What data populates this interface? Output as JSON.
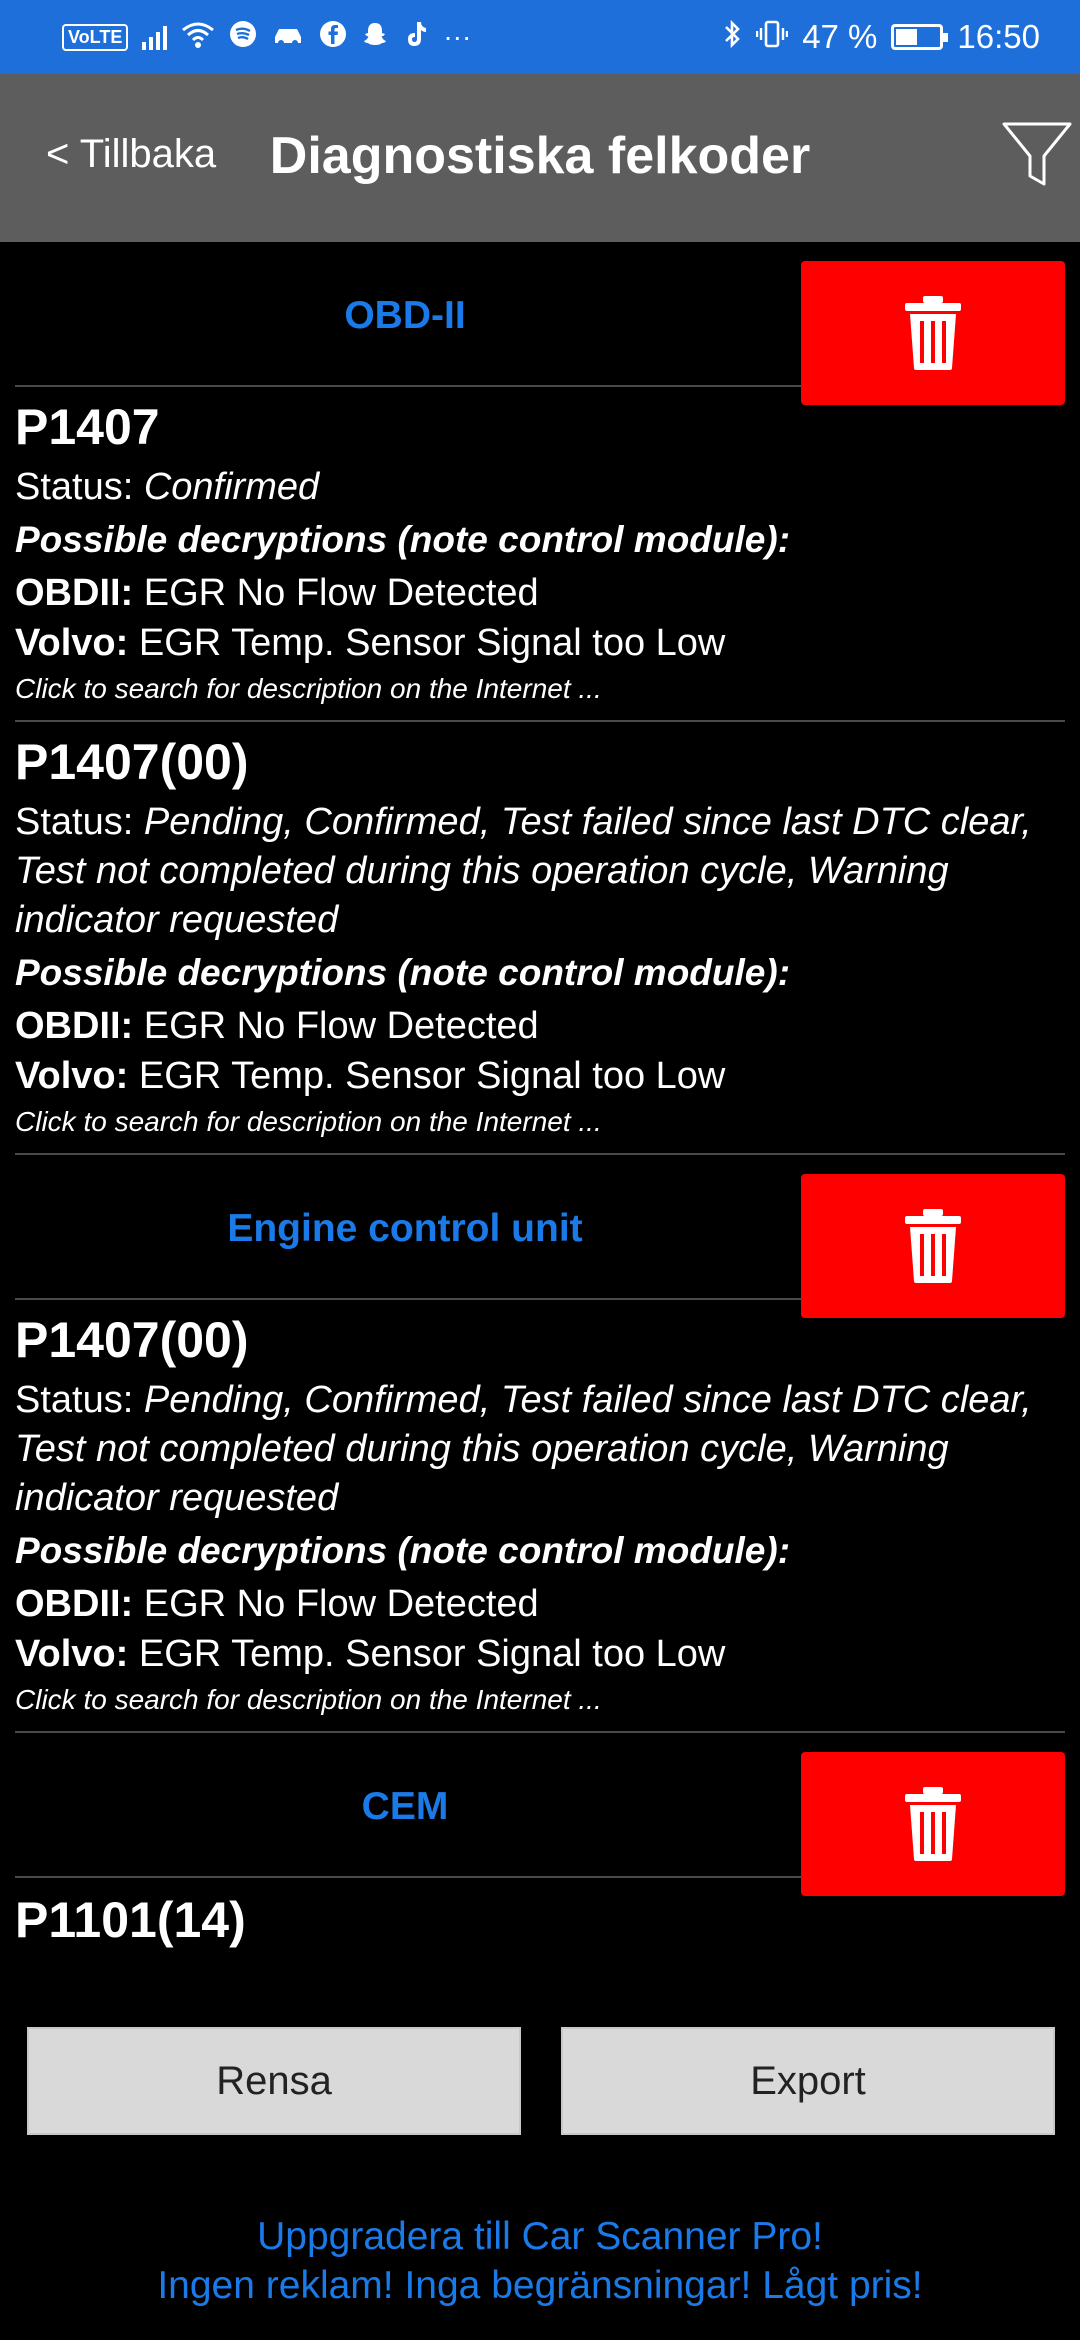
{
  "statusbar": {
    "volte": "VoLTE",
    "battery_text": "47 %",
    "battery_level": 0.47,
    "time": "16:50",
    "more": "···"
  },
  "header": {
    "back_label": "< Tillbaka",
    "title": "Diagnostiska felkoder",
    "filter_icon": "filter-icon"
  },
  "sections": [
    {
      "title": "OBD-II",
      "codes": [
        {
          "code": "P1407",
          "status_label": "Status: ",
          "status_value": "Confirmed",
          "possible": "Possible decryptions (note control module):",
          "obd_label": "OBDII:",
          "obd_text": " EGR No Flow Detected",
          "volvo_label": "Volvo:",
          "volvo_text": " EGR Temp. Sensor Signal too Low",
          "hint": "Click to search for description on the Internet ..."
        },
        {
          "code": "P1407(00)",
          "status_label": "Status: ",
          "status_value": "Pending, Confirmed, Test failed since last DTC clear, Test not completed during this operation cycle, Warning indicator requested",
          "possible": "Possible decryptions (note control module):",
          "obd_label": "OBDII:",
          "obd_text": " EGR No Flow Detected",
          "volvo_label": "Volvo:",
          "volvo_text": " EGR Temp. Sensor Signal too Low",
          "hint": "Click to search for description on the Internet ..."
        }
      ]
    },
    {
      "title": "Engine control unit",
      "codes": [
        {
          "code": "P1407(00)",
          "status_label": "Status: ",
          "status_value": "Pending, Confirmed, Test failed since last DTC clear, Test not completed during this operation cycle, Warning indicator requested",
          "possible": "Possible decryptions (note control module):",
          "obd_label": "OBDII:",
          "obd_text": " EGR No Flow Detected",
          "volvo_label": "Volvo:",
          "volvo_text": " EGR Temp. Sensor Signal too Low",
          "hint": "Click to search for description on the Internet ..."
        }
      ]
    },
    {
      "title": "CEM",
      "partial_code": "P1101(14)"
    }
  ],
  "buttons": {
    "clear": "Rensa",
    "export": "Export"
  },
  "promo": {
    "line1": "Uppgradera till Car Scanner Pro!",
    "line2": "Ingen reklam! Inga begränsningar! Lågt pris!"
  },
  "colors": {
    "statusbar": "#1e6fd9",
    "header": "#5d5d5d",
    "accent": "#1a7ae8",
    "delete": "#ff0000"
  }
}
